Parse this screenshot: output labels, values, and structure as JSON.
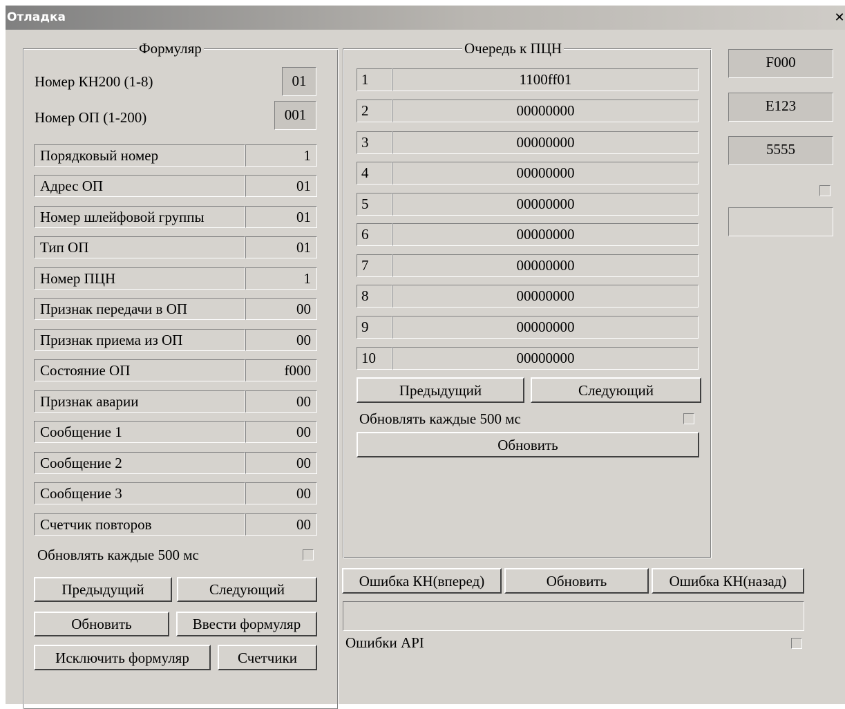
{
  "window": {
    "title": "Отладка",
    "close_glyph": "✕"
  },
  "form": {
    "legend": "Формуляр",
    "kn200_label": "Номер КН200 (1-8)",
    "kn200_value": "01",
    "op_label": "Номер ОП (1-200)",
    "op_value": "001",
    "fields": [
      {
        "label": "Порядковый номер",
        "value": "1"
      },
      {
        "label": "Адрес ОП",
        "value": "01"
      },
      {
        "label": "Номер шлейфовой группы",
        "value": "01"
      },
      {
        "label": "Тип ОП",
        "value": "01"
      },
      {
        "label": "Номер ПЦН",
        "value": "1"
      },
      {
        "label": "Признак передачи в ОП",
        "value": "00"
      },
      {
        "label": "Признак приема из ОП",
        "value": "00"
      },
      {
        "label": "Состояние ОП",
        "value": "f000"
      },
      {
        "label": "Признак аварии",
        "value": "00"
      },
      {
        "label": "Сообщение 1",
        "value": "00"
      },
      {
        "label": "Сообщение 2",
        "value": "00"
      },
      {
        "label": "Сообщение 3",
        "value": "00"
      },
      {
        "label": "Счетчик повторов",
        "value": "00"
      }
    ],
    "auto_update_label": "Обновлять каждые 500 мс",
    "prev_button": "Предыдущий",
    "next_button": "Следующий",
    "refresh_button": "Обновить",
    "enter_button": "Ввести формуляр",
    "exclude_button": "Исключить формуляр",
    "counters_button": "Счетчики"
  },
  "queue": {
    "legend": "Очередь к ПЦН",
    "rows": [
      {
        "n": "1",
        "value": "1100ff01"
      },
      {
        "n": "2",
        "value": "00000000"
      },
      {
        "n": "3",
        "value": "00000000"
      },
      {
        "n": "4",
        "value": "00000000"
      },
      {
        "n": "5",
        "value": "00000000"
      },
      {
        "n": "6",
        "value": "00000000"
      },
      {
        "n": "7",
        "value": "00000000"
      },
      {
        "n": "8",
        "value": "00000000"
      },
      {
        "n": "9",
        "value": "00000000"
      },
      {
        "n": "10",
        "value": "00000000"
      }
    ],
    "prev_button": "Предыдущий",
    "next_button": "Следующий",
    "auto_update_label": "Обновлять каждые 500 мс",
    "refresh_button": "Обновить"
  },
  "side": {
    "box1": "F000",
    "box2": "E123",
    "box3": "5555",
    "text_value": ""
  },
  "bottom": {
    "error_fwd_button": "Ошибка КН(вперед)",
    "refresh_button": "Обновить",
    "error_back_button": "Ошибка КН(назад)",
    "status_value": "",
    "api_errors_label": "Ошибки API"
  }
}
